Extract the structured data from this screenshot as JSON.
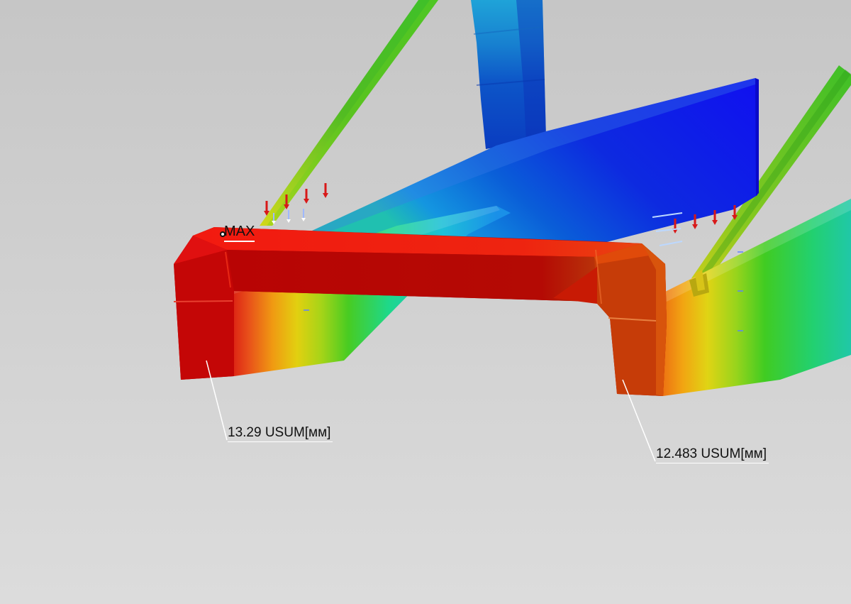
{
  "scene": {
    "background_top": "#c9c9c9",
    "background_bottom": "#dadada",
    "colormap": [
      "#1a1aff",
      "#0a52d8",
      "#1e9ff0",
      "#22d07a",
      "#3cc81e",
      "#a8d41a",
      "#e8d010",
      "#f29a10",
      "#e8501a",
      "#d81010",
      "#b50000"
    ]
  },
  "markers": {
    "max_label": "MAX"
  },
  "callouts": {
    "left": "13.29 USUM[мм]",
    "right": "12.483 USUM[мм]"
  }
}
